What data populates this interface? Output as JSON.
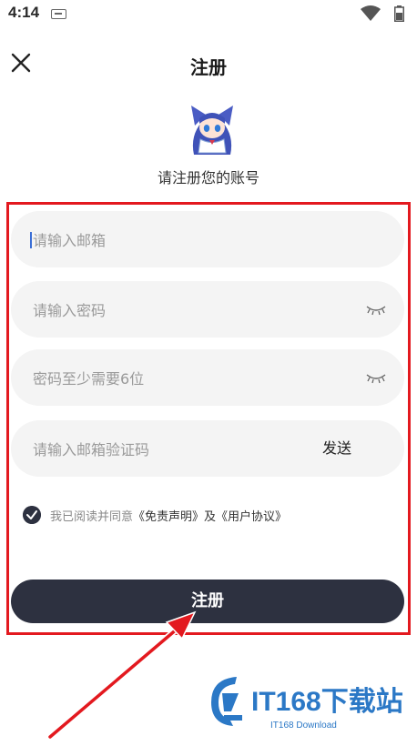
{
  "status_bar": {
    "time": "4:14"
  },
  "header": {
    "title": "注册",
    "subtitle": "请注册您的账号"
  },
  "form": {
    "email_placeholder": "请输入邮箱",
    "password_placeholder": "请输入密码",
    "confirm_placeholder": "密码至少需要6位",
    "code_placeholder": "请输入邮箱验证码",
    "send_label": "发送",
    "agreement": {
      "prefix": "我已阅读并同意",
      "disclaimer": "《免责声明》",
      "and": "及",
      "user_agreement": "《用户协议》",
      "checked": true
    },
    "submit_label": "注册"
  },
  "watermark": {
    "brand": "IT168下载站",
    "sub": "IT168 Download"
  },
  "colors": {
    "primary": "#2d3140",
    "highlight": "#e3191f",
    "watermark": "#2b78c6"
  }
}
